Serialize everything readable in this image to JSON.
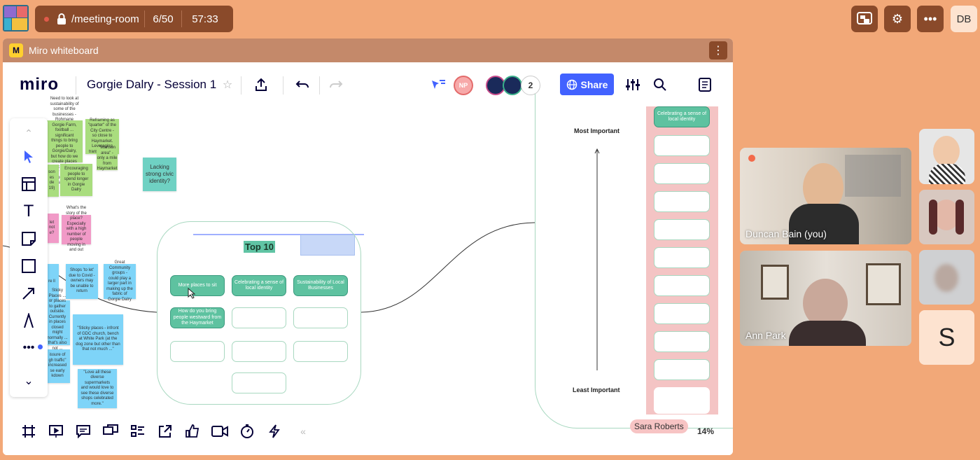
{
  "meeting": {
    "path": "/meeting-room",
    "participants_count": "6/50",
    "timer": "57:33",
    "user_initials": "DB"
  },
  "miro_window": {
    "title": "Miro whiteboard"
  },
  "miro_header": {
    "brand": "miro",
    "board_name": "Gorgie Dalry - Session 1",
    "collaborator_initials": "NP",
    "collaborator_count": "2",
    "share_label": "Share"
  },
  "board": {
    "top10_title": "Top 10",
    "top10_items": [
      "More places to sit",
      "Celebrating a sense of local identity",
      "Sustainability of Local Businesses",
      "How do you bring people westward from the Haymarket"
    ],
    "ladder_top_label": "Most Important",
    "ladder_bottom_label": "Least Important",
    "ladder_items": [
      "Celebrating a sense of local identity"
    ],
    "stickies": {
      "g1": "Need to look at sustainability of some of the businesses - Rohmane Gorgie Farm, football ... significant things to bring people to Gorgie/Dalry, but how do we create places that they can stay and shop around and support?",
      "g2": "Reframing as \"quarter\" of the City Centre - so close to Haymarket. Leveraging transformation",
      "g3": "\"Wanson area\" - only a mile from Haymarket",
      "g4": "son es de 19)",
      "g5": "Encouraging people to spend longer in Gorgie Dalry",
      "t1": "Lacking strong civic identity?",
      "p1": "let not e?",
      "p2": "What's the story of the place? Especially with a high number of people moving in and out",
      "b1": "re ll",
      "b2": "Shops 'to let' due to Covid - owners may be unable to return",
      "b3": "Great Community groups - could play a larger part in making up the fabric of Gorgie Dalry",
      "b4": "Sticky Places ... or places to gather outside. Currently in places closed might normally ... that's also not ... businesses",
      "b5": "\"Sticky places - infront of GDC church, bench at White Park (at the dog zone but other than that not much ...\"",
      "b6": "issure of gh traffic\" increased se early kdown",
      "b7": "\"Love all these diverse supermarkets and would love to see these diverse shops celebrated more.\""
    },
    "cursor_user": "Sara Roberts",
    "zoom": "14%"
  },
  "participants": [
    {
      "name": "Duncan Bain (you)"
    },
    {
      "name": "Ann Park"
    },
    {
      "initial": "S"
    }
  ]
}
